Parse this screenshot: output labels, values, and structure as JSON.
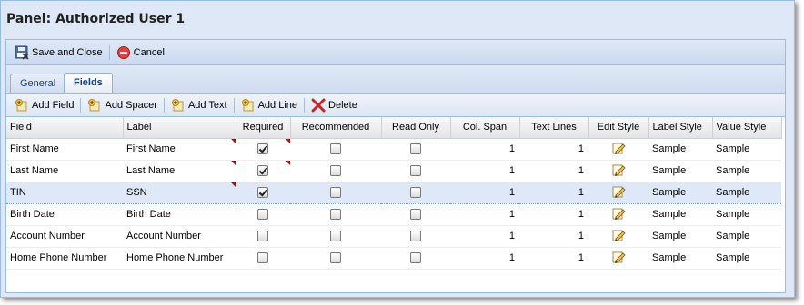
{
  "panel": {
    "title": "Panel: Authorized User 1"
  },
  "toolbar": {
    "save_close": "Save and Close",
    "cancel": "Cancel"
  },
  "tabs": [
    {
      "label": "General"
    },
    {
      "label": "Fields"
    }
  ],
  "fields_toolbar": {
    "add_field": "Add Field",
    "add_spacer": "Add Spacer",
    "add_text": "Add Text",
    "add_line": "Add Line",
    "delete": "Delete"
  },
  "grid": {
    "columns": [
      "Field",
      "Label",
      "Required",
      "Recommended",
      "Read Only",
      "Col. Span",
      "Text Lines",
      "Edit Style",
      "Label Style",
      "Value Style"
    ],
    "rows": [
      {
        "field": "First Name",
        "label": "First Name",
        "required": true,
        "recommended": false,
        "read_only": false,
        "col_span": "1",
        "text_lines": "1",
        "label_style": "Sample",
        "value_style": "Sample"
      },
      {
        "field": "Last Name",
        "label": "Last Name",
        "required": true,
        "recommended": false,
        "read_only": false,
        "col_span": "1",
        "text_lines": "1",
        "label_style": "Sample",
        "value_style": "Sample"
      },
      {
        "field": "TIN",
        "label": "SSN",
        "required": true,
        "recommended": false,
        "read_only": false,
        "col_span": "1",
        "text_lines": "1",
        "label_style": "Sample",
        "value_style": "Sample"
      },
      {
        "field": "Birth Date",
        "label": "Birth Date",
        "required": false,
        "recommended": false,
        "read_only": false,
        "col_span": "1",
        "text_lines": "1",
        "label_style": "Sample",
        "value_style": "Sample"
      },
      {
        "field": "Account Number",
        "label": "Account Number",
        "required": false,
        "recommended": false,
        "read_only": false,
        "col_span": "1",
        "text_lines": "1",
        "label_style": "Sample",
        "value_style": "Sample"
      },
      {
        "field": "Home Phone Number",
        "label": "Home Phone Number",
        "required": false,
        "recommended": false,
        "read_only": false,
        "col_span": "1",
        "text_lines": "1",
        "label_style": "Sample",
        "value_style": "Sample"
      }
    ]
  },
  "icons": {
    "save": "save-close-icon",
    "cancel": "cancel-icon",
    "add": "add-icon",
    "delete": "delete-x-icon",
    "edit": "pencil-icon"
  },
  "colors": {
    "panel_bg": "#dfe8f6",
    "border": "#99bbe8",
    "tab_text": "#15428b",
    "dirty_marker": "#cc0000",
    "delete_red": "#cc2222"
  }
}
